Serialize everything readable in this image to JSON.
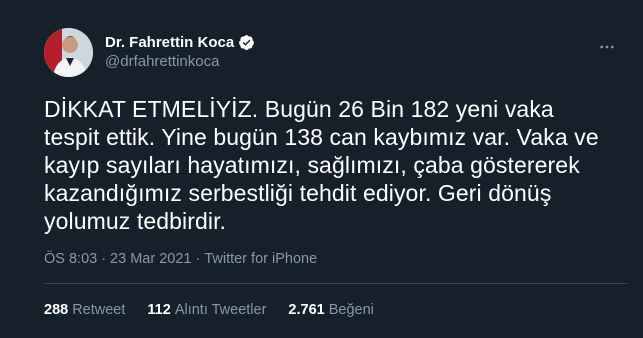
{
  "tweet": {
    "author": {
      "name": "Dr. Fahrettin Koca",
      "handle": "@drfahrettinkoca",
      "verified": true,
      "avatar_icon": "profile-photo"
    },
    "text": "DİKKAT ETMELİYİZ. Bugün 26 Bin 182 yeni vaka tespit ettik. Yine bugün 138 can kaybımız var. Vaka ve kayıp sayıları hayatımızı, sağlımızı, çaba göstererek kazandığımız serbestliği tehdit ediyor. Geri dönüş yolumuz tedbirdir.",
    "time": "ÖS 8:03",
    "separator": "·",
    "date": "23 Mar 2021",
    "source": "Twitter for iPhone",
    "stats": {
      "retweets": {
        "count": "288",
        "label": "Retweet"
      },
      "quotes": {
        "count": "112",
        "label": "Alıntı Tweetler"
      },
      "likes": {
        "count": "2.761",
        "label": "Beğeni"
      }
    }
  },
  "icons": {
    "verified": "verified-badge-icon",
    "more": "more-icon"
  },
  "colors": {
    "background": "#15202b",
    "text_primary": "#ffffff",
    "text_secondary": "#8899a6",
    "divider": "#38444d"
  }
}
